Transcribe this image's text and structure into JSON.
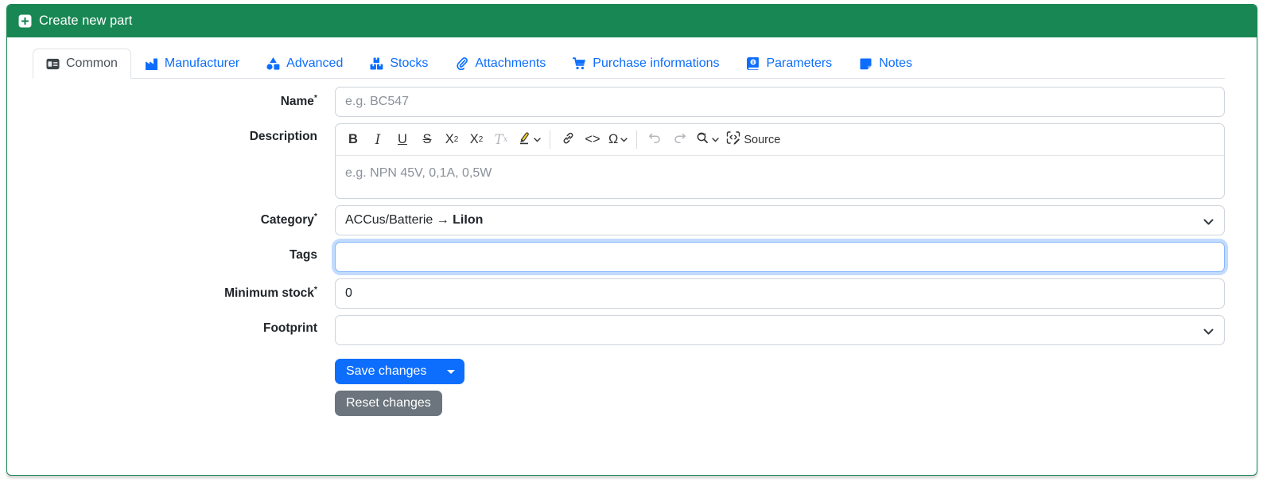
{
  "panel": {
    "title": "Create new part",
    "header_color": "#198754",
    "header_icon": "square-plus-icon"
  },
  "tabs": [
    {
      "label": "Common",
      "icon": "id-card-icon",
      "active": true
    },
    {
      "label": "Manufacturer",
      "icon": "factory-icon",
      "active": false
    },
    {
      "label": "Advanced",
      "icon": "shapes-icon",
      "active": false
    },
    {
      "label": "Stocks",
      "icon": "boxes-stacked-icon",
      "active": false
    },
    {
      "label": "Attachments",
      "icon": "paperclip-icon",
      "active": false
    },
    {
      "label": "Purchase informations",
      "icon": "shopping-cart-icon",
      "active": false
    },
    {
      "label": "Parameters",
      "icon": "book-icon",
      "active": false
    },
    {
      "label": "Notes",
      "icon": "sticky-note-icon",
      "active": false
    }
  ],
  "form": {
    "name": {
      "label": "Name",
      "required": "*",
      "placeholder": "e.g. BC547",
      "value": ""
    },
    "description": {
      "label": "Description",
      "placeholder": "e.g. NPN 45V, 0,1A, 0,5W",
      "value": ""
    },
    "category": {
      "label": "Category",
      "required": "*",
      "value_prefix": "ACCus/Batterie → ",
      "value_bold": "LiIon"
    },
    "tags": {
      "label": "Tags",
      "value": "",
      "focused": true
    },
    "minimum_stock": {
      "label": "Minimum stock",
      "required": "*",
      "value": "0"
    },
    "footprint": {
      "label": "Footprint",
      "value": ""
    }
  },
  "editor_toolbar": {
    "bold": "B",
    "italic": "I",
    "underline": "U",
    "strikethrough": "S",
    "subscript_base": "X",
    "subscript_sub": "2",
    "superscript_base": "X",
    "superscript_sup": "2",
    "remove_format_base": "T",
    "remove_format_sub": "x",
    "code": "<>",
    "special_char": "Ω",
    "source_label": "Source",
    "icons": [
      "highlight-icon",
      "link-icon",
      "undo-icon",
      "redo-icon",
      "find-replace-icon",
      "source-icon"
    ]
  },
  "buttons": {
    "save": "Save changes",
    "reset": "Reset changes"
  },
  "colors": {
    "accent_green": "#198754",
    "link_blue": "#0d6efd",
    "primary_btn": "#0d6efd",
    "secondary_btn": "#6c757d",
    "focus_ring": "#86b7fe"
  }
}
